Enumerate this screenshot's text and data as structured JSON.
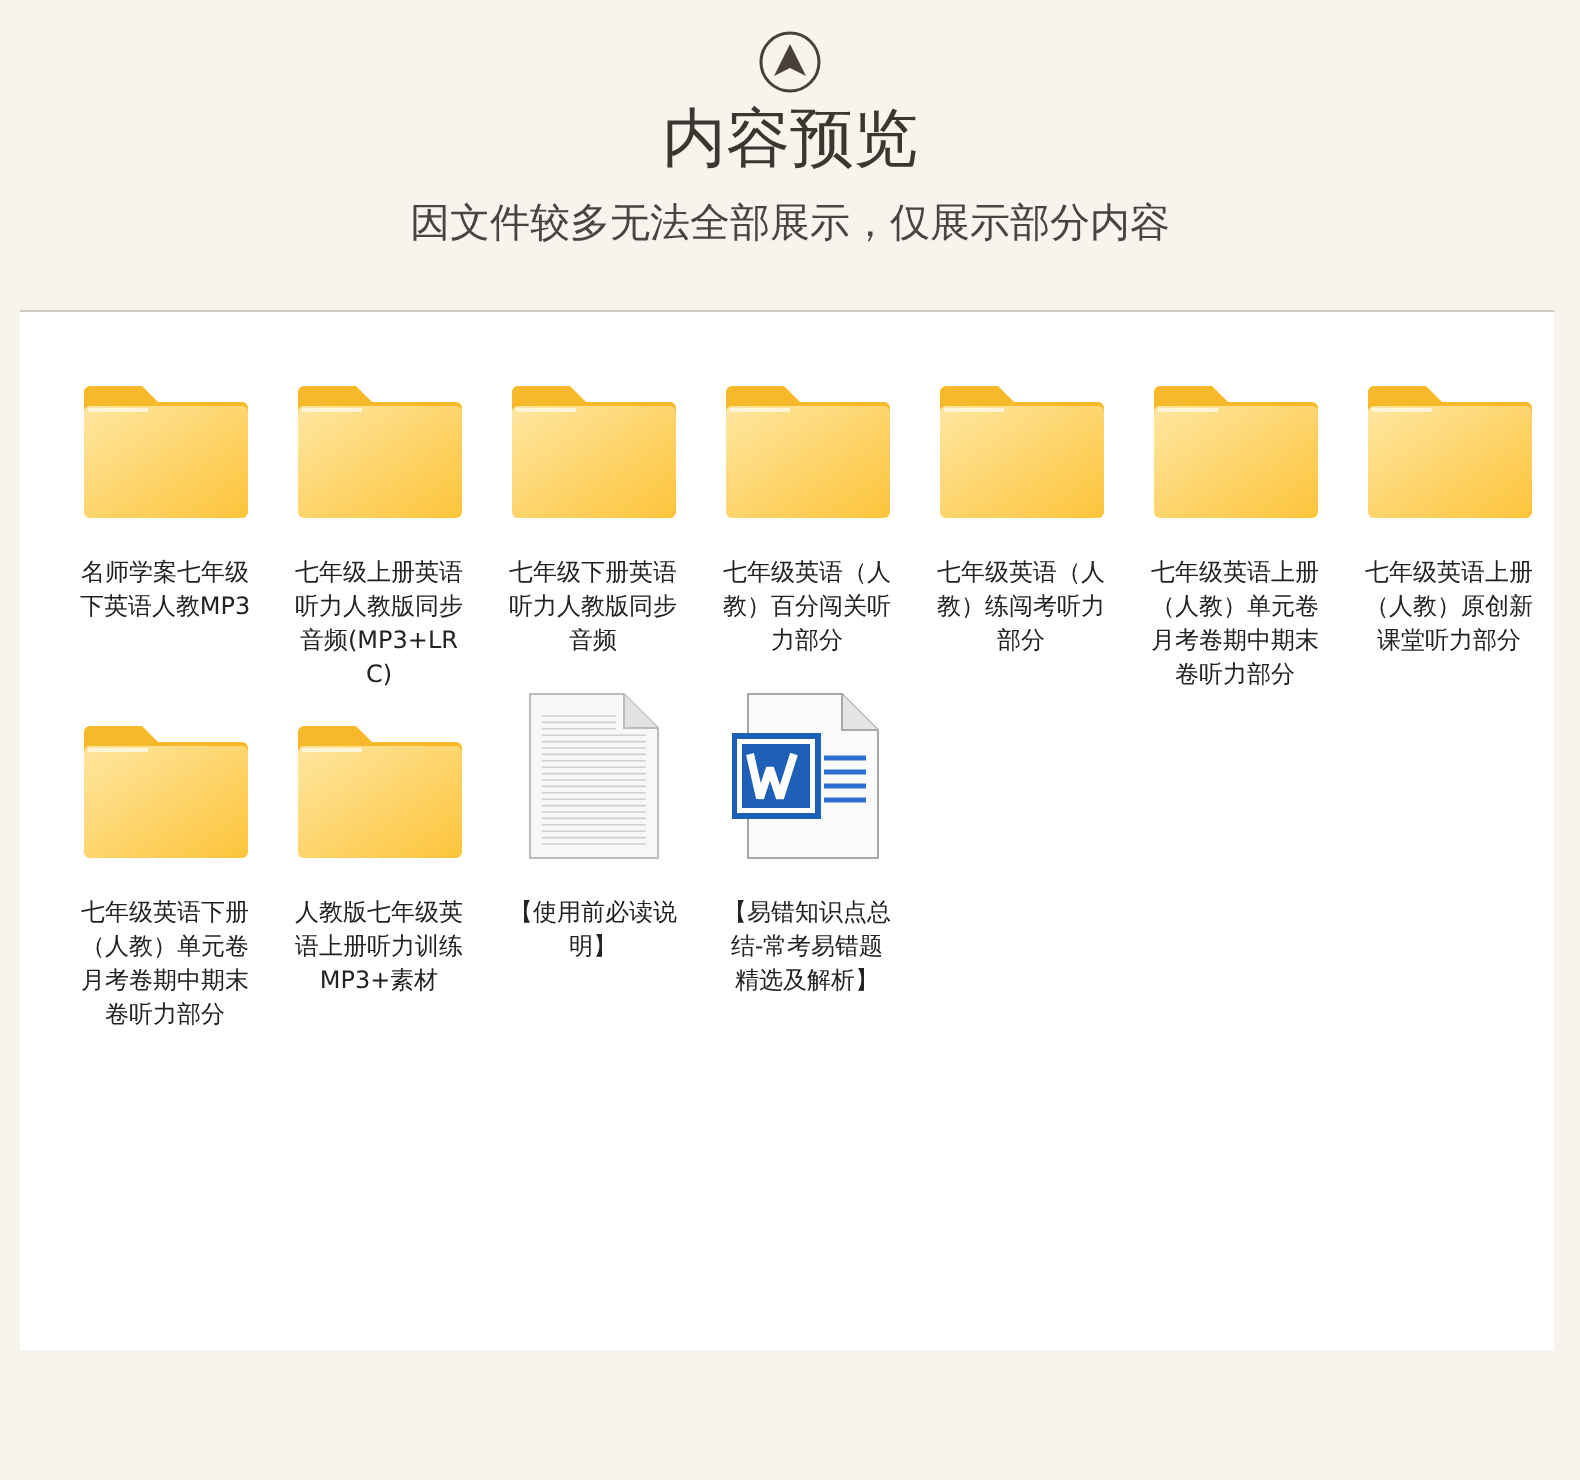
{
  "header": {
    "title": "内容预览",
    "subtitle": "因文件较多无法全部展示，仅展示部分内容"
  },
  "files": [
    {
      "kind": "folder",
      "name": "名师学案七年级下英语人教MP3"
    },
    {
      "kind": "folder",
      "name": "七年级上册英语听力人教版同步音频(MP3+LRC)"
    },
    {
      "kind": "folder",
      "name": "七年级下册英语听力人教版同步音频"
    },
    {
      "kind": "folder",
      "name": "七年级英语（人教）百分闯关听力部分"
    },
    {
      "kind": "folder",
      "name": "七年级英语（人教）练闯考听力部分"
    },
    {
      "kind": "folder",
      "name": "七年级英语上册（人教）单元卷月考卷期中期末卷听力部分"
    },
    {
      "kind": "folder",
      "name": "七年级英语上册（人教）原创新课堂听力部分"
    },
    {
      "kind": "folder",
      "name": "七年级英语下册（人教）单元卷月考卷期中期末卷听力部分"
    },
    {
      "kind": "folder",
      "name": "人教版七年级英语上册听力训练MP3+素材"
    },
    {
      "kind": "text",
      "name": "【使用前必读说明】"
    },
    {
      "kind": "word",
      "name": "【易错知识点总结-常考易错题精选及解析】"
    }
  ]
}
